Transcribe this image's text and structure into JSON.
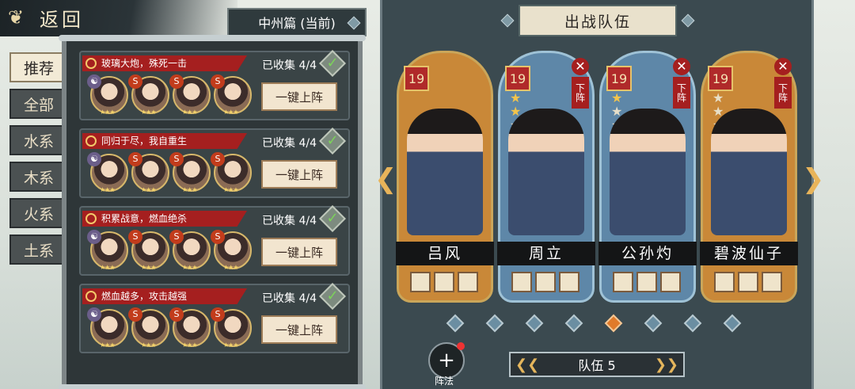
{
  "back_label": "返回",
  "chapter_label": "中州篇 (当前)",
  "tabs": [
    "推荐",
    "全部",
    "水系",
    "木系",
    "火系",
    "土系"
  ],
  "combos": [
    {
      "name": "玻璃大炮，殊死一击",
      "collected": "已收集 4/4",
      "button": "一键上阵",
      "elements": [
        "☯",
        "S",
        "S",
        "S"
      ]
    },
    {
      "name": "同归于尽，我自重生",
      "collected": "已收集 4/4",
      "button": "一键上阵",
      "elements": [
        "☯",
        "S",
        "S",
        "S"
      ]
    },
    {
      "name": "积累战意，燃血绝杀",
      "collected": "已收集 4/4",
      "button": "一键上阵",
      "elements": [
        "☯",
        "S",
        "S",
        "S"
      ]
    },
    {
      "name": "燃血越多，攻击越强",
      "collected": "已收集 4/4",
      "button": "一键上阵",
      "elements": [
        "☯",
        "S",
        "S",
        "S"
      ]
    }
  ],
  "team_title": "出战队伍",
  "cards": [
    {
      "level": "19",
      "name": "吕风",
      "stars": 0,
      "removable": false
    },
    {
      "level": "19",
      "name": "周立",
      "stars": 2,
      "removable": true,
      "remove_label": "下阵"
    },
    {
      "level": "19",
      "name": "公孙灼",
      "stars": 1,
      "removable": true,
      "remove_label": "下阵"
    },
    {
      "level": "19",
      "name": "碧波仙子",
      "stars": 0,
      "removable": true,
      "remove_label": "下阵"
    }
  ],
  "formation_label": "阵法",
  "team_label": "队伍 5",
  "team_page_active": 4,
  "colors": {
    "accent": "#a51f1f",
    "gold": "#caa65a",
    "active_dot": "#e07a2a"
  }
}
